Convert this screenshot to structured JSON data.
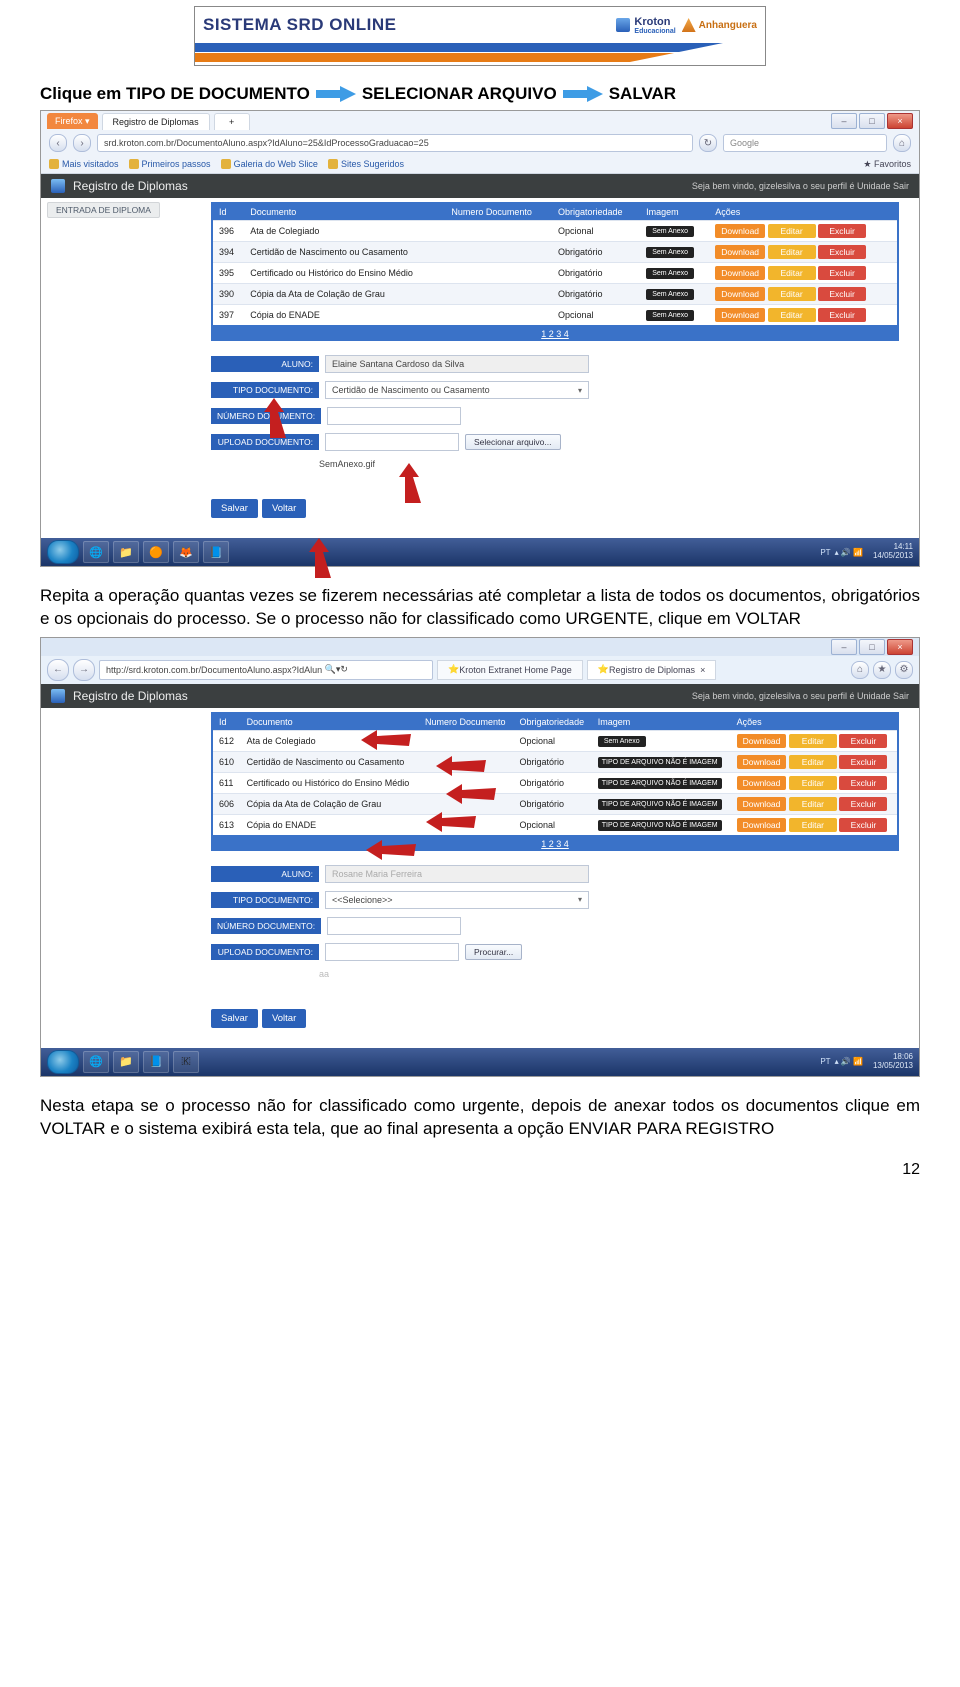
{
  "banner": {
    "title": "SISTEMA SRD ONLINE",
    "brand1": "Kroton",
    "brand1_sub": "Educacional",
    "brand2": "Anhanguera"
  },
  "instruction1": {
    "p1": "Clique em TIPO DE DOCUMENTO",
    "p2": "SELECIONAR ARQUIVO",
    "p3": "SALVAR"
  },
  "paragraph1": "Repita a operação quantas vezes se fizerem necessárias até completar a lista de todos os documentos, obrigatórios e os opcionais do processo. Se o processo não for classificado como URGENTE, clique em VOLTAR",
  "paragraph2": "Nesta etapa se o processo não for classificado como urgente, depois de anexar todos os documentos clique em VOLTAR e o sistema exibirá esta tela, que ao final apresenta a opção ENVIAR PARA REGISTRO",
  "page_number": "12",
  "shot1": {
    "firefox": "Firefox ▾",
    "tab": "Registro de Diplomas",
    "plus": "+",
    "url": "srd.kroton.com.br/DocumentoAluno.aspx?IdAluno=25&IdProcessoGraduacao=25",
    "search": "Google",
    "favorites": "Favoritos",
    "bk1": "Mais visitados",
    "bk2": "Primeiros passos",
    "bk3": "Galeria do Web Slice",
    "bk4": "Sites Sugeridos",
    "app_title": "Registro de Diplomas",
    "welcome": "Seja bem vindo, gizelesilva   o seu perfil é   Unidade   Sair",
    "side": "ENTRADA DE DIPLOMA",
    "th": {
      "id": "Id",
      "doc": "Documento",
      "num": "Numero Documento",
      "obr": "Obrigatoriedade",
      "img": "Imagem",
      "ac": "Ações"
    },
    "rows": [
      {
        "id": "396",
        "doc": "Ata de Colegiado",
        "num": "",
        "obr": "Opcional",
        "img": "Sem\nAnexo"
      },
      {
        "id": "394",
        "doc": "Certidão de Nascimento ou Casamento",
        "num": "",
        "obr": "Obrigatório",
        "img": "Sem\nAnexo"
      },
      {
        "id": "395",
        "doc": "Certificado ou Histórico do Ensino Médio",
        "num": "",
        "obr": "Obrigatório",
        "img": "Sem\nAnexo"
      },
      {
        "id": "390",
        "doc": "Cópia da Ata de Colação de Grau",
        "num": "",
        "obr": "Obrigatório",
        "img": "Sem\nAnexo"
      },
      {
        "id": "397",
        "doc": "Cópia do ENADE",
        "num": "",
        "obr": "Opcional",
        "img": "Sem\nAnexo"
      }
    ],
    "action_dl": "Download",
    "action_ed": "Editar",
    "action_ex": "Excluir",
    "pager": "1 2 3 4",
    "form": {
      "l_aluno": "ALUNO:",
      "v_aluno": "Elaine Santana Cardoso da Silva",
      "l_tipo": "TIPO DOCUMENTO:",
      "v_tipo": "Certidão de Nascimento ou Casamento",
      "l_num": "NÚMERO DOCUMENTO:",
      "v_num": "",
      "l_upl": "UPLOAD DOCUMENTO:",
      "btn_sel": "Selecionar arquivo...",
      "fn": "SemAnexo.gif",
      "b_salvar": "Salvar",
      "b_voltar": "Voltar"
    },
    "clock_time": "14:11",
    "clock_date": "14/05/2013",
    "lang": "PT"
  },
  "shot2": {
    "url": "http://srd.kroton.com.br/DocumentoAluno.aspx?IdAlun",
    "mag": "🔍",
    "ref": "↻",
    "tab1": "Kroton Extranet Home Page",
    "tab2": "Registro de Diplomas",
    "tabx": "×",
    "app_title": "Registro de Diplomas",
    "welcome": "Seja bem vindo, gizelesilva   o seu perfil é   Unidade   Sair",
    "th": {
      "id": "Id",
      "doc": "Documento",
      "num": "Numero Documento",
      "obr": "Obrigatoriedade",
      "img": "Imagem",
      "ac": "Ações"
    },
    "rows": [
      {
        "id": "612",
        "doc": "Ata de Colegiado",
        "obr": "Opcional",
        "img": "Sem\nAnexo"
      },
      {
        "id": "610",
        "doc": "Certidão de Nascimento ou Casamento",
        "obr": "Obrigatório",
        "img": "TIPO DE\nARQUIVO\nNÃO É\nIMAGEM"
      },
      {
        "id": "611",
        "doc": "Certificado ou Histórico do Ensino Médio",
        "obr": "Obrigatório",
        "img": "TIPO DE\nARQUIVO\nNÃO É\nIMAGEM"
      },
      {
        "id": "606",
        "doc": "Cópia da Ata de Colação de Grau",
        "obr": "Obrigatório",
        "img": "TIPO DE\nARQUIVO\nNÃO É\nIMAGEM"
      },
      {
        "id": "613",
        "doc": "Cópia do ENADE",
        "obr": "Opcional",
        "img": "TIPO DE\nARQUIVO\nNÃO É\nIMAGEM"
      }
    ],
    "action_dl": "Download",
    "action_ed": "Editar",
    "action_ex": "Excluir",
    "pager": "1 2 3 4",
    "form": {
      "l_aluno": "ALUNO:",
      "v_aluno": "Rosane Maria Ferreira",
      "l_tipo": "TIPO DOCUMENTO:",
      "v_tipo": "<<Selecione>>",
      "l_num": "NÚMERO DOCUMENTO:",
      "v_num": "",
      "l_upl": "UPLOAD DOCUMENTO:",
      "btn_sel": "Procurar...",
      "note": "aa",
      "b_salvar": "Salvar",
      "b_voltar": "Voltar"
    },
    "clock_time": "18:06",
    "clock_date": "13/05/2013",
    "lang": "PT"
  }
}
